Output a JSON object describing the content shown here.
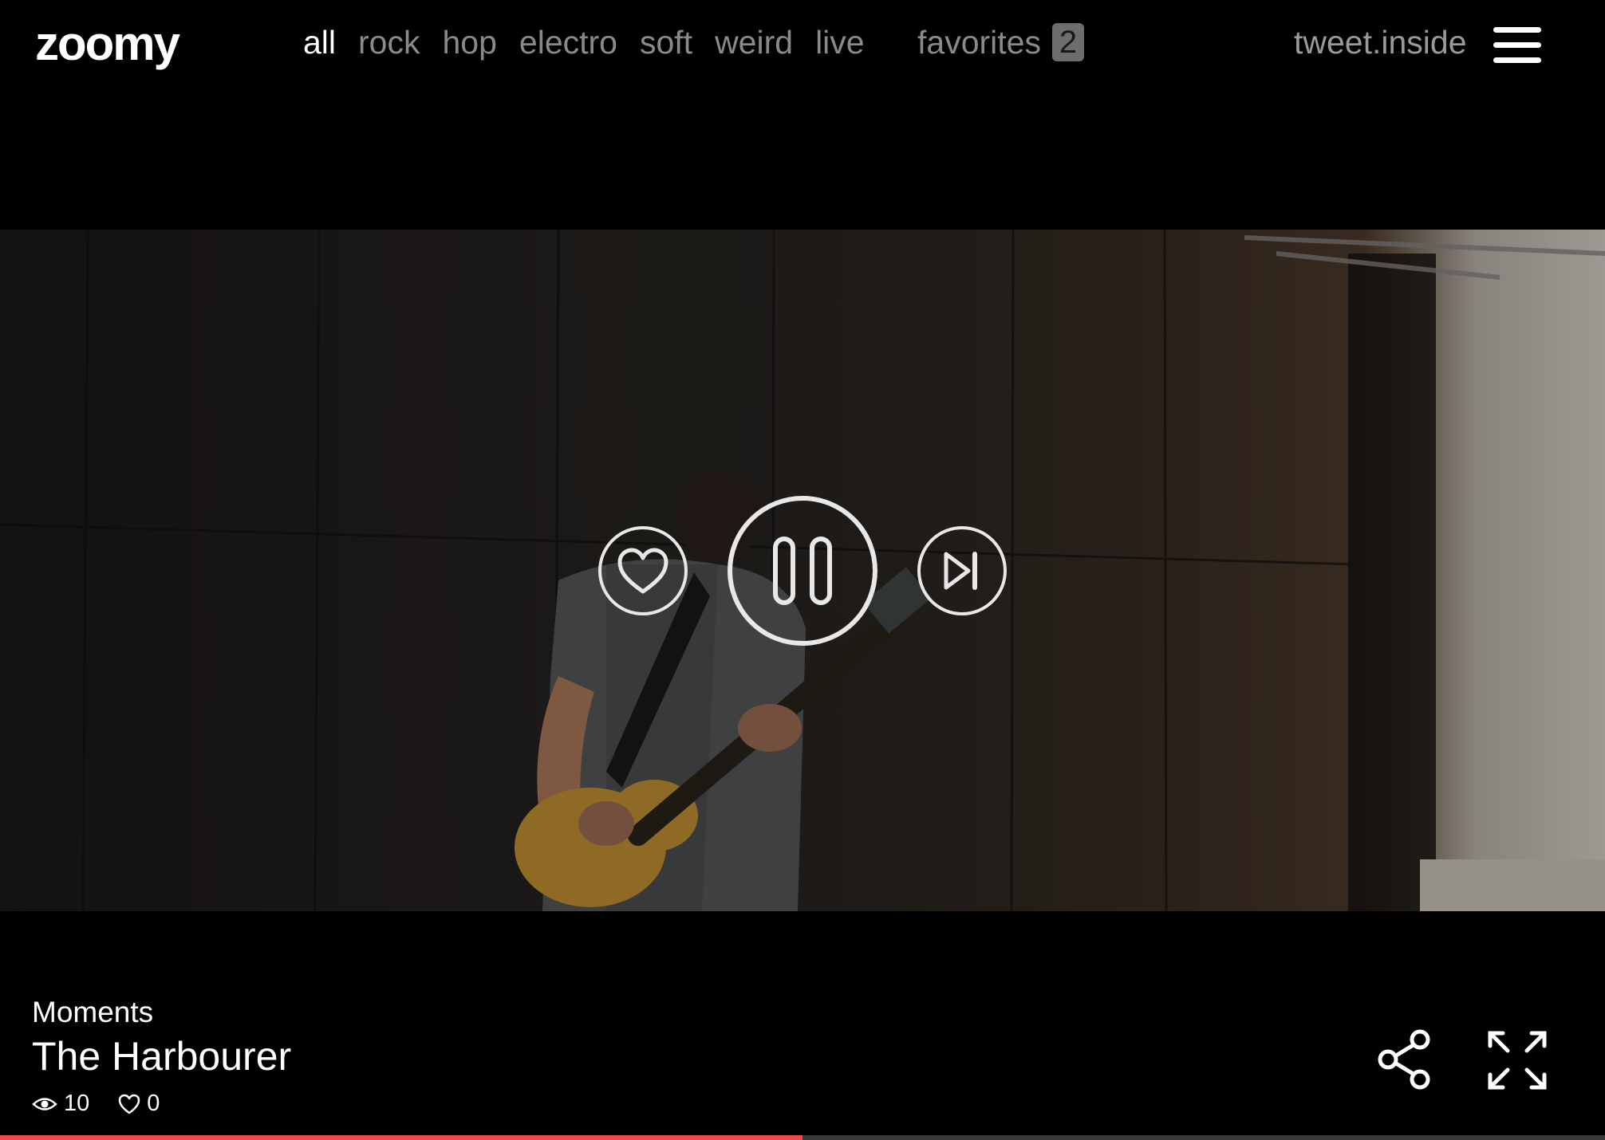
{
  "app": {
    "logo": "zoomy"
  },
  "nav": {
    "items": [
      {
        "label": "all",
        "active": true
      },
      {
        "label": "rock",
        "active": false
      },
      {
        "label": "hop",
        "active": false
      },
      {
        "label": "electro",
        "active": false
      },
      {
        "label": "soft",
        "active": false
      },
      {
        "label": "weird",
        "active": false
      },
      {
        "label": "live",
        "active": false
      }
    ],
    "favorites_label": "favorites",
    "favorites_count": "2",
    "tweet_label": "tweet.inside",
    "menu_icon": "hamburger-icon"
  },
  "player": {
    "state": "playing",
    "controls": {
      "like_icon": "heart-icon",
      "pause_icon": "pause-icon",
      "next_icon": "skip-next-icon"
    },
    "progress": 0.5
  },
  "track": {
    "album": "Moments",
    "title": "The Harbourer",
    "views": "10",
    "likes": "0"
  },
  "actions": {
    "share_icon": "share-icon",
    "fullscreen_icon": "expand-icon"
  },
  "colors": {
    "accent": "#f04b4b",
    "nav_inactive": "#8a8a8a",
    "badge_bg": "#6d6d6d"
  }
}
